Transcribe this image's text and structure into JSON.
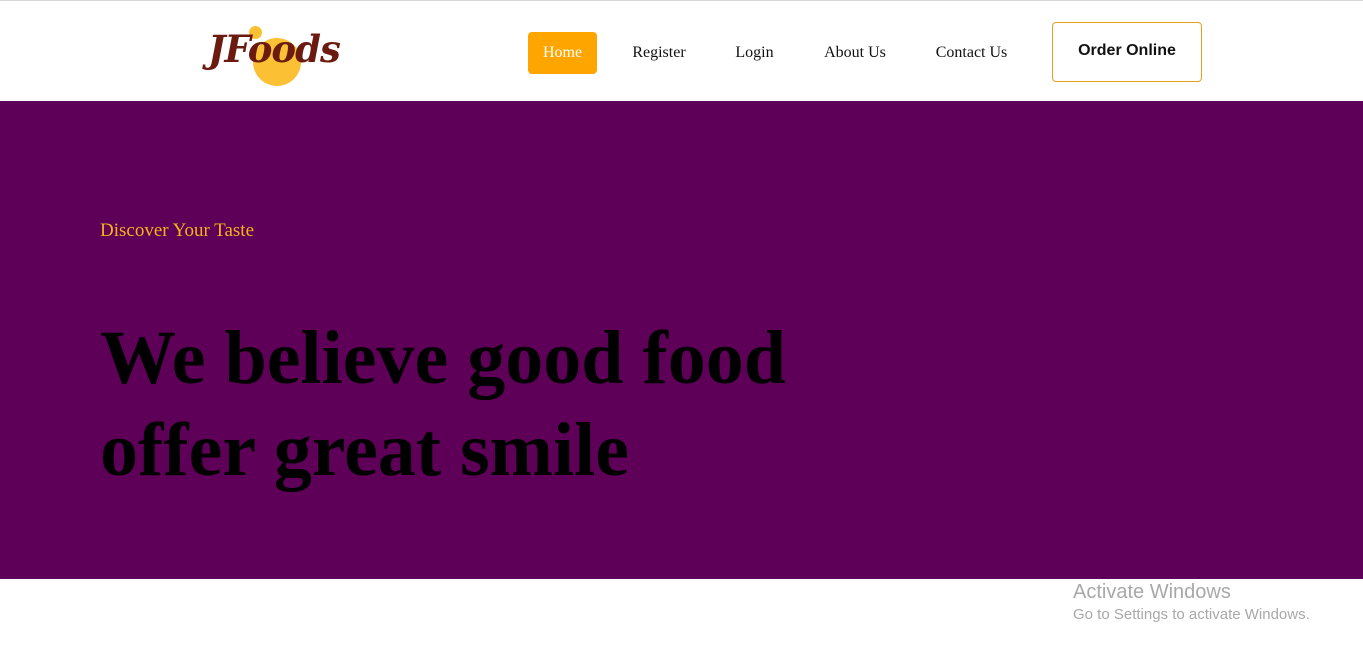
{
  "header": {
    "logo_text": "JFoods",
    "nav": [
      {
        "label": "Home",
        "active": true
      },
      {
        "label": "Register",
        "active": false
      },
      {
        "label": "Login",
        "active": false
      },
      {
        "label": "About Us",
        "active": false
      },
      {
        "label": "Contact Us",
        "active": false
      }
    ],
    "order_button": "Order Online"
  },
  "hero": {
    "tagline": "Discover Your Taste",
    "headline_line1": "We believe good food",
    "headline_line2": "offer great smile"
  },
  "watermark": {
    "title": "Activate Windows",
    "subtitle": "Go to Settings to activate Windows."
  },
  "colors": {
    "accent": "#ffa500",
    "hero_background": "#5e0057",
    "tagline": "#f5b31b",
    "logo_circle": "#fcc034",
    "logo_text": "#6b1a10"
  }
}
